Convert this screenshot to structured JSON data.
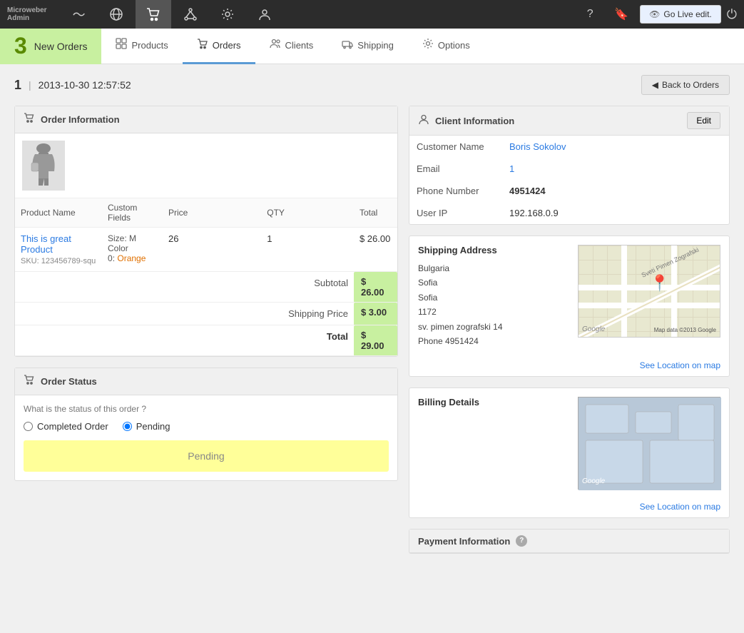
{
  "app": {
    "logo": "Microweber",
    "logo_sub": "Admin",
    "go_live_label": "Go Live edit."
  },
  "top_nav": {
    "items": [
      {
        "id": "analytics",
        "icon": "〜",
        "active": false
      },
      {
        "id": "globe",
        "icon": "🌐",
        "active": false
      },
      {
        "id": "cart",
        "icon": "🛒",
        "active": true
      },
      {
        "id": "network",
        "icon": "⬡",
        "active": false
      },
      {
        "id": "settings",
        "icon": "⚙",
        "active": false
      },
      {
        "id": "user",
        "icon": "👤",
        "active": false
      }
    ]
  },
  "sub_nav": {
    "new_orders_count": "3",
    "new_orders_label": "New Orders",
    "tabs": [
      {
        "id": "products",
        "label": "Products",
        "icon": "🖼",
        "active": false
      },
      {
        "id": "orders",
        "label": "Orders",
        "icon": "🛒",
        "active": true
      },
      {
        "id": "clients",
        "label": "Clients",
        "icon": "👥",
        "active": false
      },
      {
        "id": "shipping",
        "label": "Shipping",
        "icon": "📦",
        "active": false
      },
      {
        "id": "options",
        "label": "Options",
        "icon": "⚙",
        "active": false
      }
    ]
  },
  "order": {
    "id": "1",
    "date": "2013-10-30 12:57:52",
    "back_btn_label": "Back to Orders",
    "order_info_label": "Order Information",
    "client_info_label": "Client Information",
    "order_status_label": "Order Status",
    "edit_label": "Edit"
  },
  "product_table": {
    "headers": [
      "Product Name",
      "Custom Fields",
      "Price",
      "QTY",
      "Total"
    ],
    "rows": [
      {
        "name": "This is great Product",
        "sku": "SKU: 123456789-squ",
        "custom_field_size_label": "Size:",
        "custom_field_size_val": "M",
        "custom_field_color_label": "Color",
        "custom_field_color_val": "Orange",
        "color_prefix": "0:",
        "price": "26",
        "qty": "1",
        "total": "$ 26.00"
      }
    ],
    "subtotal_label": "Subtotal",
    "subtotal_value": "$ 26.00",
    "shipping_label": "Shipping Price",
    "shipping_value": "$ 3.00",
    "total_label": "Total",
    "total_value": "$ 29.00"
  },
  "order_status": {
    "question": "What is the status of this order ?",
    "options": [
      "Completed Order",
      "Pending"
    ],
    "selected": "Pending",
    "display_value": "Pending"
  },
  "client": {
    "name_label": "Customer Name",
    "name_value": "Boris Sokolov",
    "email_label": "Email",
    "email_value": "1",
    "phone_label": "Phone Number",
    "phone_value": "4951424",
    "ip_label": "User IP",
    "ip_value": "192.168.0.9"
  },
  "shipping_address": {
    "title": "Shipping Address",
    "country": "Bulgaria",
    "city1": "Sofia",
    "city2": "Sofia",
    "postal": "1172",
    "street": "sv. pimen zografski 14",
    "phone_label": "Phone",
    "phone": "4951424",
    "map_data_label": "Map data ©2013 Google",
    "see_location_label": "See Location on map"
  },
  "billing": {
    "title": "Billing Details",
    "see_location_label": "See Location on map"
  },
  "payment": {
    "title": "Payment Information",
    "help_label": "?"
  }
}
